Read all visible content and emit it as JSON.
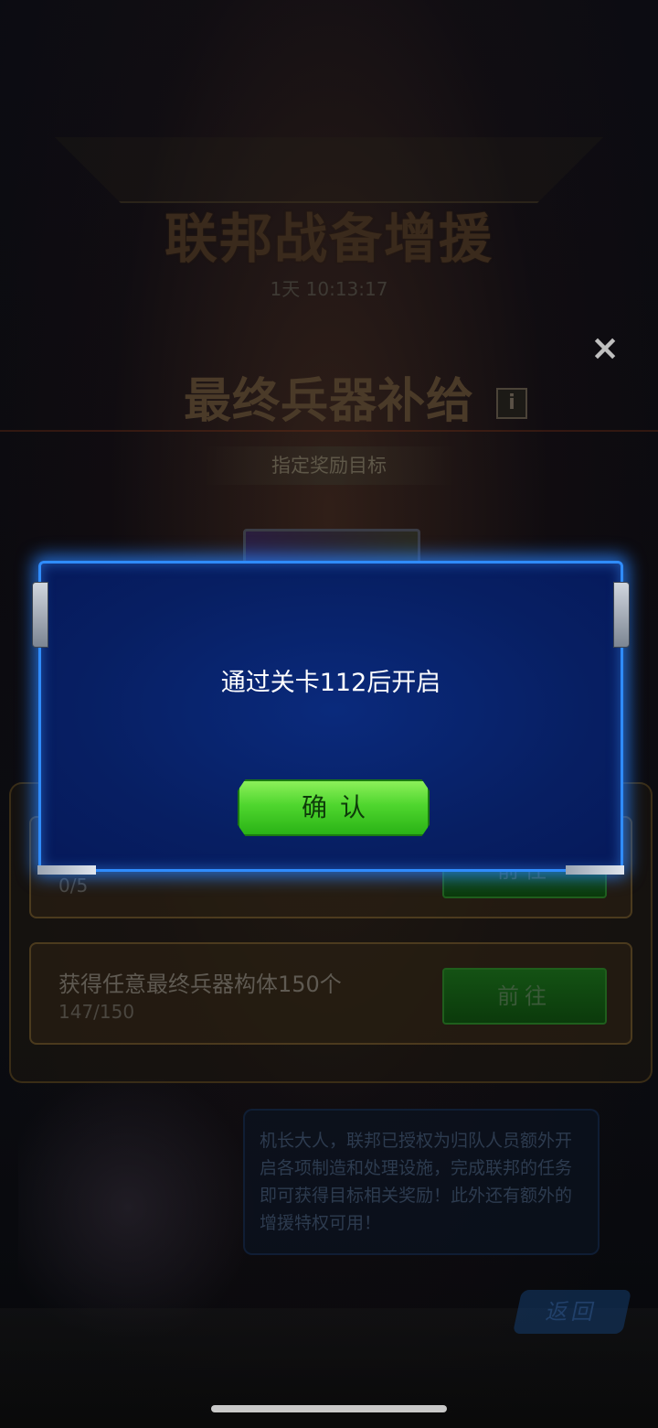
{
  "background": {
    "event_title": "联邦战备增援",
    "timer": "1天 10:13:17",
    "subtitle": "最终兵器补给",
    "target_tag": "指定奖励目标",
    "tasks": [
      {
        "name": "",
        "progress": "0/5",
        "button": "前往"
      },
      {
        "name": "获得任意最终兵器构体150个",
        "progress": "147/150",
        "button": "前往"
      }
    ],
    "npc_dialog": "机长大人，联邦已授权为归队人员额外开启各项制造和处理设施，完成联邦的任务即可获得目标相关奖励！此外还有额外的增援特权可用！",
    "back_label": "返回"
  },
  "icons": {
    "close": "×",
    "info": "i"
  },
  "modal": {
    "message": "通过关卡112后开启",
    "confirm_label": "确认"
  },
  "colors": {
    "modal_bg": "#06195a",
    "modal_border": "#2f8cff",
    "confirm_green": "#4fd62e"
  }
}
